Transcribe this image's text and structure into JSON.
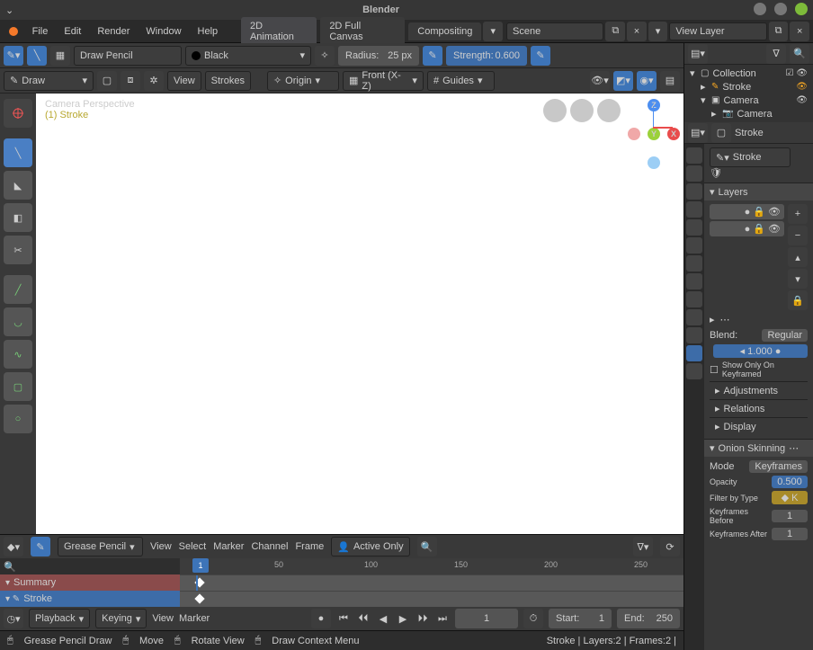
{
  "title": "Blender",
  "window_controls": {
    "min": "–",
    "max": "◇",
    "close": "×"
  },
  "menu": [
    "File",
    "Edit",
    "Render",
    "Window",
    "Help"
  ],
  "workspace_tabs": [
    "2D Animation",
    "2D Full Canvas",
    "Compositing"
  ],
  "active_workspace": "2D Animation",
  "scene_label": "Scene",
  "viewlayer_label": "View Layer",
  "tool_header": {
    "brush_name": "Draw Pencil",
    "color_name": "Black",
    "radius_label": "Radius:",
    "radius_value": "25 px",
    "strength_label": "Strength:",
    "strength_value": "0.600"
  },
  "tool_header2": {
    "mode": "Draw",
    "view": "View",
    "strokes": "Strokes",
    "origin_label": "Origin",
    "front_label": "Front (X-Z)",
    "guides_label": "Guides"
  },
  "left_tools": [
    "cursor",
    "draw",
    "fill",
    "erase",
    "cut",
    "line",
    "arc",
    "curve",
    "box",
    "circle"
  ],
  "viewport_overlay": {
    "line1": "Camera Perspective",
    "line2": "(1) Stroke"
  },
  "outliner": {
    "items": [
      {
        "label": "Collection",
        "icon": "collection"
      },
      {
        "label": "Stroke",
        "icon": "grease",
        "selected": true
      },
      {
        "label": "Camera",
        "icon": "camera"
      },
      {
        "label": "Camera",
        "icon": "camera-data"
      }
    ]
  },
  "properties": {
    "context_item": "Stroke",
    "object_name": "Stroke",
    "layers": {
      "title": "Layers",
      "layers_count": 2,
      "blend_label": "Blend:",
      "blend_value": "Regular",
      "opacity_value": "1.000",
      "show_only": "Show Only On Keyframed",
      "sub_panels": [
        "Adjustments",
        "Relations",
        "Display"
      ]
    },
    "onion": {
      "title": "Onion Skinning",
      "mode_label": "Mode",
      "mode_value": "Keyframes",
      "opacity_label": "Opacity",
      "opacity_value": "0.500",
      "filter_label": "Filter by Type",
      "filter_value": "◆ K",
      "keyfr_before_label": "Keyframes Before",
      "keyfr_before_value": "1",
      "keyfr_after_label": "Keyframes After",
      "keyfr_after_value": "1"
    }
  },
  "timeline": {
    "editor": "Grease Pencil",
    "menus": [
      "View",
      "Select",
      "Marker",
      "Channel",
      "Frame"
    ],
    "filter": "Active Only",
    "ticks": [
      "50",
      "100",
      "150",
      "200",
      "250"
    ],
    "current_frame": "1",
    "summary": "Summary",
    "stroke_row": "Stroke",
    "playback": "Playback",
    "keying": "Keying",
    "view2": "View",
    "marker2": "Marker",
    "frame_current": "1",
    "start_label": "Start:",
    "start_value": "1",
    "end_label": "End:",
    "end_value": "250"
  },
  "status": {
    "mode": "Grease Pencil Draw",
    "move": "Move",
    "rotate": "Rotate View",
    "context": "Draw Context Menu",
    "info": "Stroke | Layers:2 | Frames:2 |"
  }
}
